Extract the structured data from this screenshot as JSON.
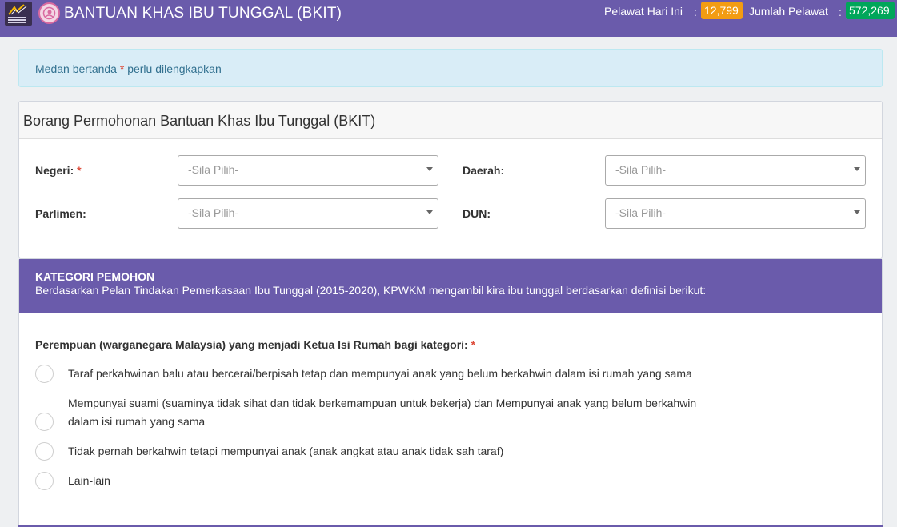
{
  "header": {
    "title": "BANTUAN KHAS IBU TUNGGAL (BKIT)",
    "visitors_today_label": "Pelawat Hari Ini",
    "visitors_today_value": "12,799",
    "total_visitors_label": "Jumlah Pelawat",
    "total_visitors_value": "572,269",
    "colon": ":",
    "colors": {
      "bar": "#6a5bab",
      "badge_today": "#f39c12",
      "badge_total": "#00a65a"
    }
  },
  "alert": {
    "text_before": "Medan bertanda ",
    "asterisk": "*",
    "text_after": " perlu dilengkapkan"
  },
  "form": {
    "title": "Borang Permohonan Bantuan Khas Ibu Tunggal (BKIT)",
    "fields": {
      "negeri": {
        "label": "Negeri:",
        "required": "*",
        "placeholder": "-Sila Pilih-"
      },
      "daerah": {
        "label": "Daerah:",
        "placeholder": "-Sila Pilih-"
      },
      "parlimen": {
        "label": "Parlimen:",
        "placeholder": "-Sila Pilih-"
      },
      "dun": {
        "label": "DUN:",
        "placeholder": "-Sila Pilih-"
      }
    }
  },
  "category": {
    "title": "KATEGORI PEMOHON",
    "description": "Berdasarkan Pelan Tindakan Pemerkasaan Ibu Tunggal (2015-2020), KPWKM mengambil kira ibu tunggal berdasarkan definisi berikut:",
    "question": "Perempuan (warganegara Malaysia) yang menjadi Ketua Isi Rumah bagi kategori:",
    "question_required": "*",
    "options": [
      {
        "line1": "Taraf perkahwinan balu atau bercerai/berpisah tetap dan mempunyai anak yang belum berkahwin dalam isi rumah yang sama"
      },
      {
        "line1": "Mempunyai suami (suaminya tidak sihat dan tidak berkemampuan untuk bekerja) dan Mempunyai anak yang belum berkahwin",
        "line2": "dalam isi rumah yang sama"
      },
      {
        "line1": "Tidak pernah berkahwin tetapi mempunyai anak (anak angkat atau anak tidak sah taraf)"
      },
      {
        "line1": "Lain-lain"
      }
    ]
  }
}
